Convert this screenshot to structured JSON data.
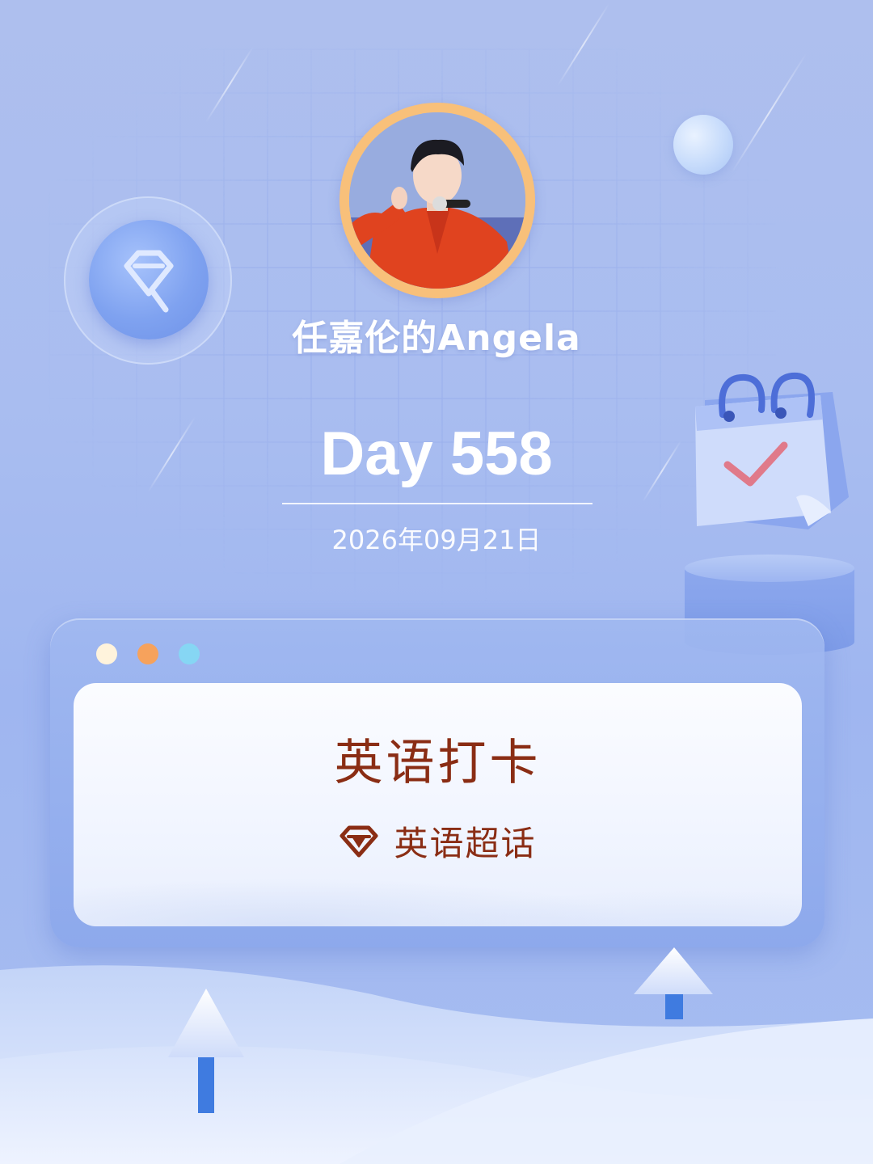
{
  "profile": {
    "username": "任嘉伦的Angela"
  },
  "checkin": {
    "day_label": "Day 558",
    "date": "2026年09月21日"
  },
  "card": {
    "title": "英语打卡",
    "topic": "英语超话"
  },
  "window_dots": [
    {
      "name": "cream",
      "color": "#fff3dc"
    },
    {
      "name": "orange",
      "color": "#f6a25c"
    },
    {
      "name": "cyan",
      "color": "#86d6f4"
    }
  ],
  "colors": {
    "accent_text": "#8a2d14",
    "avatar_ring": "#f8c07a",
    "background": "#a9bdf0"
  },
  "icons": [
    "diamond-badge-icon",
    "calendar-check-icon",
    "diamond-icon"
  ]
}
